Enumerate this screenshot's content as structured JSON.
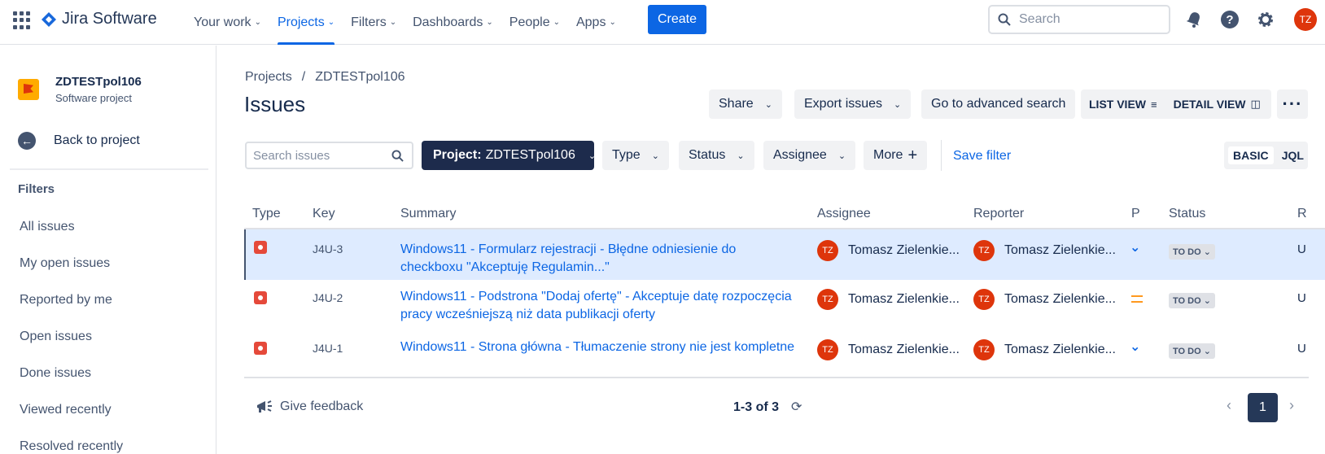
{
  "topnav": {
    "brand": "Jira Software",
    "items": [
      {
        "label": "Your work",
        "active": false
      },
      {
        "label": "Projects",
        "active": true
      },
      {
        "label": "Filters",
        "active": false
      },
      {
        "label": "Dashboards",
        "active": false
      },
      {
        "label": "People",
        "active": false
      },
      {
        "label": "Apps",
        "active": false
      }
    ],
    "create_label": "Create",
    "search_placeholder": "Search",
    "avatar_initials": "TZ",
    "accent_color": "#0c66e4"
  },
  "sidebar": {
    "project_name": "ZDTESTpol106",
    "project_type": "Software project",
    "back_label": "Back to project",
    "filters_title": "Filters",
    "filters": [
      "All issues",
      "My open issues",
      "Reported by me",
      "Open issues",
      "Done issues",
      "Viewed recently",
      "Resolved recently"
    ]
  },
  "main": {
    "breadcrumb": [
      "Projects",
      "/",
      "ZDTESTpol106"
    ],
    "title": "Issues",
    "toolbar": {
      "share": "Share",
      "export": "Export issues",
      "advanced": "Go to advanced search",
      "list_view": "LIST VIEW",
      "detail_view": "DETAIL VIEW"
    },
    "filters": {
      "search_placeholder": "Search issues",
      "project_label": "Project:",
      "project_value": "ZDTESTpol106",
      "type": "Type",
      "status": "Status",
      "assignee": "Assignee",
      "more": "More",
      "save_filter": "Save filter",
      "basic": "BASIC",
      "jql": "JQL"
    },
    "columns": [
      "Type",
      "Key",
      "Summary",
      "Assignee",
      "Reporter",
      "P",
      "Status",
      "R"
    ],
    "rows": [
      {
        "key": "J4U-3",
        "summary": "Windows11 - Formularz rejestracji - Błędne odniesienie do checkboxu \"Akceptuję Regulamin...\"",
        "assignee": "Tomasz Zielenkie...",
        "reporter": "Tomasz Zielenkie...",
        "priority": "low",
        "status": "TO DO",
        "r": "U",
        "selected": true
      },
      {
        "key": "J4U-2",
        "summary": "Windows11 - Podstrona \"Dodaj ofertę\" - Akceptuje datę rozpoczęcia pracy wcześniejszą niż data publikacji oferty",
        "assignee": "Tomasz Zielenkie...",
        "reporter": "Tomasz Zielenkie...",
        "priority": "medium",
        "status": "TO DO",
        "r": "U",
        "selected": false
      },
      {
        "key": "J4U-1",
        "summary": "Windows11 - Strona główna - Tłumaczenie strony nie jest kompletne",
        "assignee": "Tomasz Zielenkie...",
        "reporter": "Tomasz Zielenkie...",
        "priority": "low",
        "status": "TO DO",
        "r": "U",
        "selected": false
      }
    ],
    "avatar_initials": "TZ",
    "footer": {
      "feedback": "Give feedback",
      "count": "1-3 of 3",
      "page": "1"
    }
  }
}
